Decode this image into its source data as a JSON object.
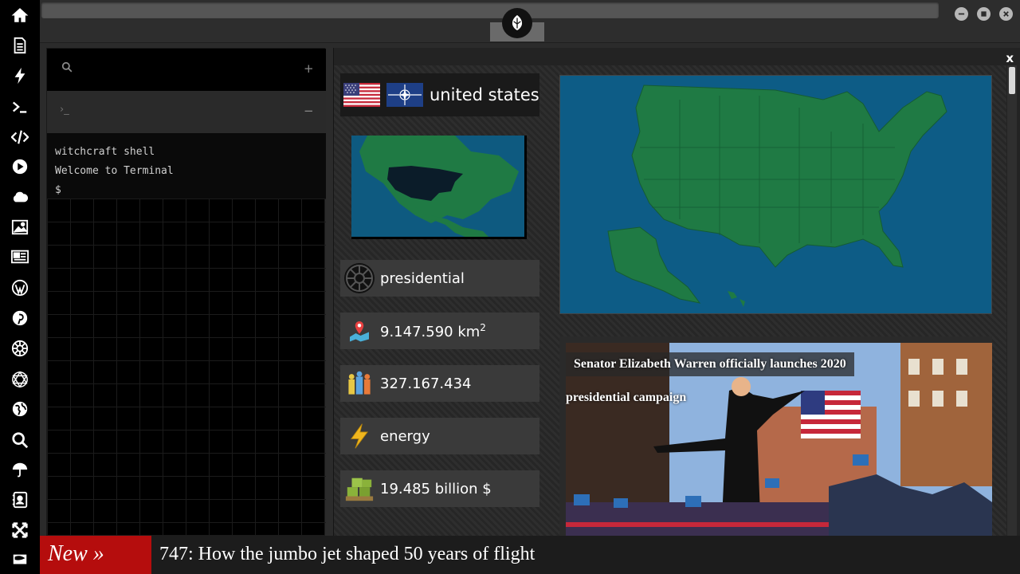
{
  "sidebar": {
    "icons": [
      "home-icon",
      "document-icon",
      "bolt-icon",
      "terminal-icon",
      "code-icon",
      "play-icon",
      "cloud-icon",
      "image-icon",
      "newspaper-icon",
      "wordpress-icon",
      "pinterest-icon",
      "empire-icon",
      "grid-globe-icon",
      "globe-icon",
      "search-icon",
      "umbrella-icon",
      "contacts-icon",
      "expand-icon",
      "flag-icon"
    ]
  },
  "terminal": {
    "search_icon": "search-icon",
    "add_label": "+",
    "tab_prompt": "›_",
    "minimize_label": "−",
    "lines": [
      "witchcraft shell",
      "Welcome to Terminal",
      "$"
    ]
  },
  "country": {
    "name": "united states",
    "government": "presidential",
    "area_value": "9.147.590 km",
    "area_sup": "2",
    "population": "327.167.434",
    "resource": "energy",
    "gdp": "19.485 billion $"
  },
  "panel": {
    "close_label": "x"
  },
  "news": {
    "headline_line1": "Senator Elizabeth Warren officially launches 2020",
    "headline_line2": "presidential campaign"
  },
  "ticker": {
    "badge": "New »",
    "text": "747: How the jumbo jet shaped 50 years of flight"
  },
  "colors": {
    "ticker_badge": "#b50d0d",
    "map_ocean": "#0d5c86",
    "map_land": "#1f7a44"
  }
}
